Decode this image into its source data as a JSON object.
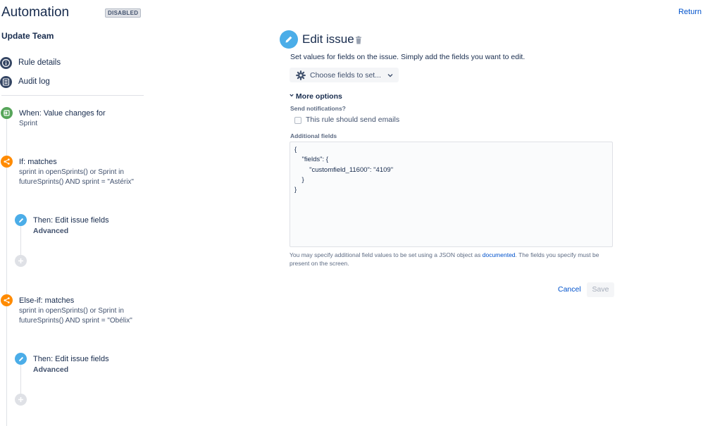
{
  "header": {
    "title": "Automation",
    "status_badge": "DISABLED",
    "return_label": "Return"
  },
  "rule": {
    "name": "Update Team"
  },
  "nav": {
    "rule_details": "Rule details",
    "audit_log": "Audit log"
  },
  "tree": {
    "trigger": {
      "title": "When: Value changes for",
      "subtitle": "Sprint"
    },
    "condition1": {
      "title": "If: matches",
      "line1": "sprint in openSprints() or Sprint in",
      "line2": "futureSprints() AND sprint = \"Astérix\""
    },
    "action1": {
      "title": "Then: Edit issue fields",
      "subtitle": "Advanced"
    },
    "condition2": {
      "title": "Else-if: matches",
      "line1": "sprint in openSprints() or Sprint in",
      "line2": "futureSprints() AND sprint = \"Obélix\""
    },
    "action2": {
      "title": "Then: Edit issue fields",
      "subtitle": "Advanced"
    }
  },
  "editor": {
    "title": "Edit issue",
    "description": "Set values for fields on the issue. Simply add the fields you want to edit.",
    "choose_fields_label": "Choose fields to set...",
    "more_options_label": "More options",
    "send_notifications_label": "Send notifications?",
    "send_emails_label": "This rule should send emails",
    "send_emails_checked": false,
    "additional_fields_label": "Additional fields",
    "additional_fields_value": "{\n    \"fields\": {\n        \"customfield_11600\": \"4109\"\n    }\n}",
    "help_prefix": "You may specify additional field values to be set using a JSON object as ",
    "help_link": "documented",
    "help_suffix": ". The fields you specify must be present on the screen.",
    "cancel_label": "Cancel",
    "save_label": "Save"
  },
  "colors": {
    "trigger": "#57a55a",
    "condition": "#ff8b00",
    "action": "#4bade8",
    "nav_icon": "#344563",
    "link": "#0052cc"
  },
  "icons": {
    "rule_details": "info-icon",
    "audit_log": "list-icon",
    "trigger": "trigger-icon",
    "condition": "branch-icon",
    "action": "pencil-icon",
    "add": "plus-icon",
    "delete": "trash-icon",
    "choose": "gear-icon",
    "dropdown": "chevron-down-icon",
    "expand": "chevron-down-icon"
  }
}
